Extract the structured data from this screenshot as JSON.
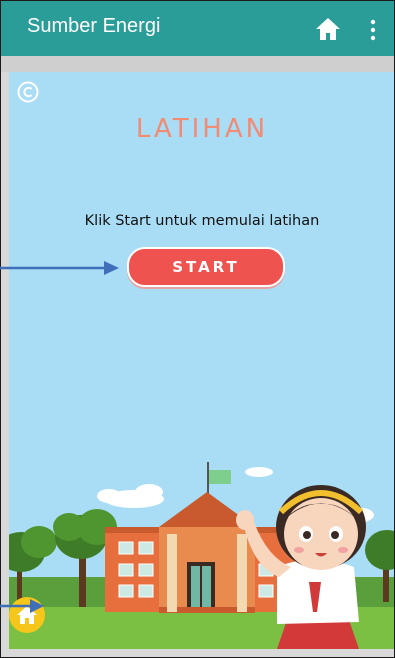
{
  "appbar": {
    "title": "Sumber Energi",
    "home_icon": "home-icon",
    "more_icon": "more-vert-icon",
    "color": "#2a9d99"
  },
  "content": {
    "copyright_icon": "copyright-icon",
    "heading": "LATIHAN",
    "instruction": "Klik Start untuk memulai latihan",
    "start_label": "START",
    "start_color": "#ef5350",
    "heading_color": "#f28b74",
    "home_button_icon": "home-icon",
    "home_button_color": "#f6c61b"
  },
  "annotations": {
    "arrow_color": "#3f6fb8"
  }
}
